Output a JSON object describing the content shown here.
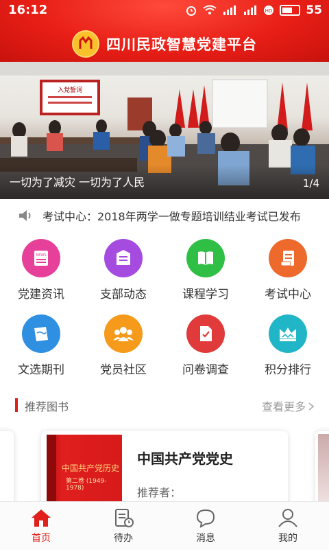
{
  "status_bar": {
    "time": "16:12",
    "battery": "55"
  },
  "header": {
    "title": "四川民政智慧党建平台"
  },
  "banner": {
    "caption": "一切为了减灾 一切为了人民",
    "pager": "1/4",
    "poster_text": "入党誓词"
  },
  "notice": {
    "text": "考试中心：2018年两学一做专题培训结业考试已发布"
  },
  "grid": [
    {
      "label": "党建资讯",
      "color": "#e6409a",
      "icon": "news-icon"
    },
    {
      "label": "支部动态",
      "color": "#a54be0",
      "icon": "message-icon"
    },
    {
      "label": "课程学习",
      "color": "#2fbf44",
      "icon": "book-icon"
    },
    {
      "label": "考试中心",
      "color": "#ee6a2c",
      "icon": "exam-icon"
    },
    {
      "label": "文选期刊",
      "color": "#2f8fe0",
      "icon": "journal-icon"
    },
    {
      "label": "党员社区",
      "color": "#f59a1a",
      "icon": "community-icon"
    },
    {
      "label": "问卷调查",
      "color": "#e03a3a",
      "icon": "survey-icon"
    },
    {
      "label": "积分排行",
      "color": "#21b6c7",
      "icon": "crown-icon"
    }
  ],
  "section": {
    "title": "推荐图书",
    "more": "查看更多"
  },
  "book": {
    "title": "中国共产党党史",
    "recommender_label": "推荐者：",
    "cover_title": "中国共产党历史",
    "cover_sub": "第二卷 (1949-1978)"
  },
  "tabs": [
    {
      "label": "首页",
      "active": true
    },
    {
      "label": "待办",
      "active": false
    },
    {
      "label": "消息",
      "active": false
    },
    {
      "label": "我的",
      "active": false
    }
  ],
  "colors": {
    "brand_red": "#e0201a"
  }
}
